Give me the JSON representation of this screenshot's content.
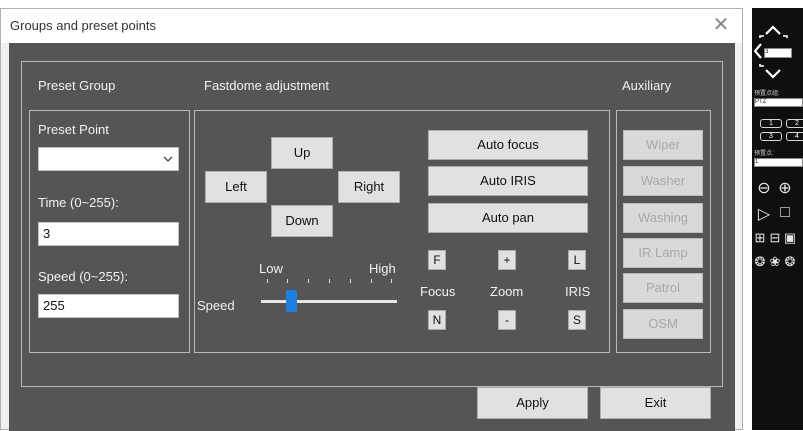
{
  "dialog": {
    "title": "Groups and preset points",
    "close_glyph": "✕"
  },
  "sections": {
    "preset_group": "Preset Group",
    "fastdome": "Fastdome adjustment",
    "auxiliary": "Auxiliary"
  },
  "preset": {
    "point_label": "Preset Point",
    "point_value": "",
    "time_label": "Time (0~255):",
    "time_value": "3",
    "speed_label": "Speed (0~255):",
    "speed_value": "255"
  },
  "ptz": {
    "up": "Up",
    "down": "Down",
    "left": "Left",
    "right": "Right",
    "auto_focus": "Auto focus",
    "auto_iris": "Auto IRIS",
    "auto_pan": "Auto pan",
    "speed_low": "Low",
    "speed_high": "High",
    "speed_label": "Speed",
    "speed_level_fraction": 0.2,
    "focus_label": "Focus",
    "zoom_label": "Zoom",
    "iris_label": "IRIS",
    "focus_far": "F",
    "focus_near": "N",
    "zoom_in": "+",
    "zoom_out": "-",
    "iris_large": "L",
    "iris_small": "S"
  },
  "auxiliary": {
    "items": [
      "Wiper",
      "Washer",
      "Washing",
      "IR Lamp",
      "Patrol",
      "OSM"
    ]
  },
  "footer": {
    "apply": "Apply",
    "exit": "Exit"
  },
  "side_panel": {
    "channel_value": "3",
    "label_1": "预置点组:",
    "select_1": "PTZ",
    "keys": [
      "1",
      "2",
      "3",
      "4"
    ],
    "label_2": "预置点:",
    "select_2": "1"
  },
  "colors": {
    "dark_background": "#555555",
    "frame_border": "#b9b9b9",
    "button_face": "#e1e1e1",
    "slider_thumb": "#1e7fe0"
  }
}
